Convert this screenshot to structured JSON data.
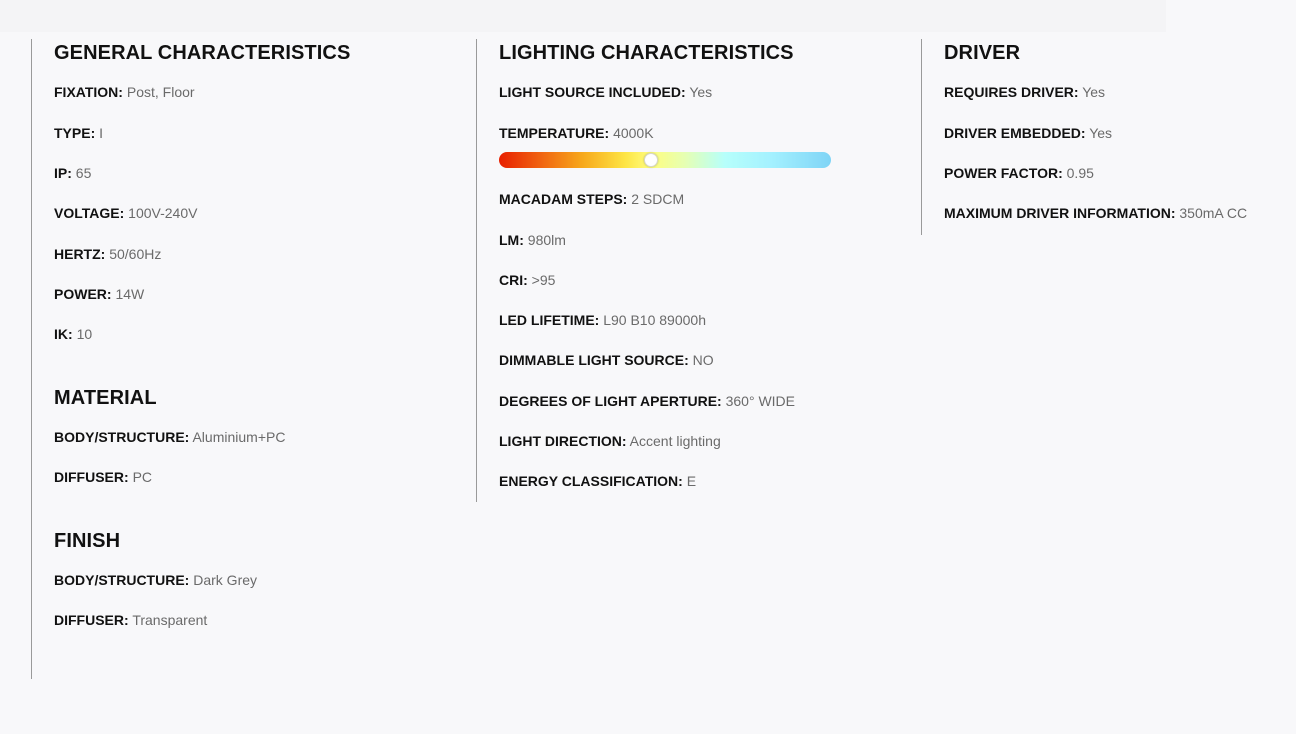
{
  "general": {
    "title": "GENERAL CHARACTERISTICS",
    "items": [
      {
        "label": "FIXATION:",
        "value": "Post, Floor"
      },
      {
        "label": "TYPE:",
        "value": "I"
      },
      {
        "label": "IP:",
        "value": "65"
      },
      {
        "label": "VOLTAGE:",
        "value": "100V-240V"
      },
      {
        "label": "HERTZ:",
        "value": "50/60Hz"
      },
      {
        "label": "POWER:",
        "value": "14W"
      },
      {
        "label": "IK:",
        "value": "10"
      }
    ]
  },
  "material": {
    "title": "MATERIAL",
    "items": [
      {
        "label": "BODY/STRUCTURE:",
        "value": "Aluminium+PC"
      },
      {
        "label": "DIFFUSER:",
        "value": "PC"
      }
    ]
  },
  "finish": {
    "title": "FINISH",
    "items": [
      {
        "label": "BODY/STRUCTURE:",
        "value": "Dark Grey"
      },
      {
        "label": "DIFFUSER:",
        "value": "Transparent"
      }
    ]
  },
  "lighting": {
    "title": "LIGHTING CHARACTERISTICS",
    "items": [
      {
        "label": "LIGHT SOURCE INCLUDED:",
        "value": "Yes"
      },
      {
        "label": "TEMPERATURE:",
        "value": "4000K"
      },
      {
        "label": "MACADAM STEPS:",
        "value": "2 SDCM"
      },
      {
        "label": "LM:",
        "value": "980lm"
      },
      {
        "label": "CRI:",
        "value": ">95"
      },
      {
        "label": "LED LIFETIME:",
        "value": "L90 B10 89000h"
      },
      {
        "label": "DIMMABLE LIGHT SOURCE:",
        "value": "NO"
      },
      {
        "label": "DEGREES OF LIGHT APERTURE:",
        "value": "360° WIDE"
      },
      {
        "label": "LIGHT DIRECTION:",
        "value": "Accent lighting"
      },
      {
        "label": "ENERGY CLASSIFICATION:",
        "value": "E"
      }
    ],
    "temperature_scale": {
      "position_fraction": 0.457,
      "gradient_colors": [
        "#e82000",
        "#f7a81b",
        "#fefe80",
        "#b6fffb",
        "#7fd4f6"
      ]
    }
  },
  "driver": {
    "title": "DRIVER",
    "items": [
      {
        "label": "REQUIRES DRIVER:",
        "value": "Yes"
      },
      {
        "label": "DRIVER EMBEDDED:",
        "value": "Yes"
      },
      {
        "label": "POWER FACTOR:",
        "value": "0.95"
      },
      {
        "label": "MAXIMUM DRIVER INFORMATION:",
        "value": "350mA CC"
      }
    ]
  }
}
